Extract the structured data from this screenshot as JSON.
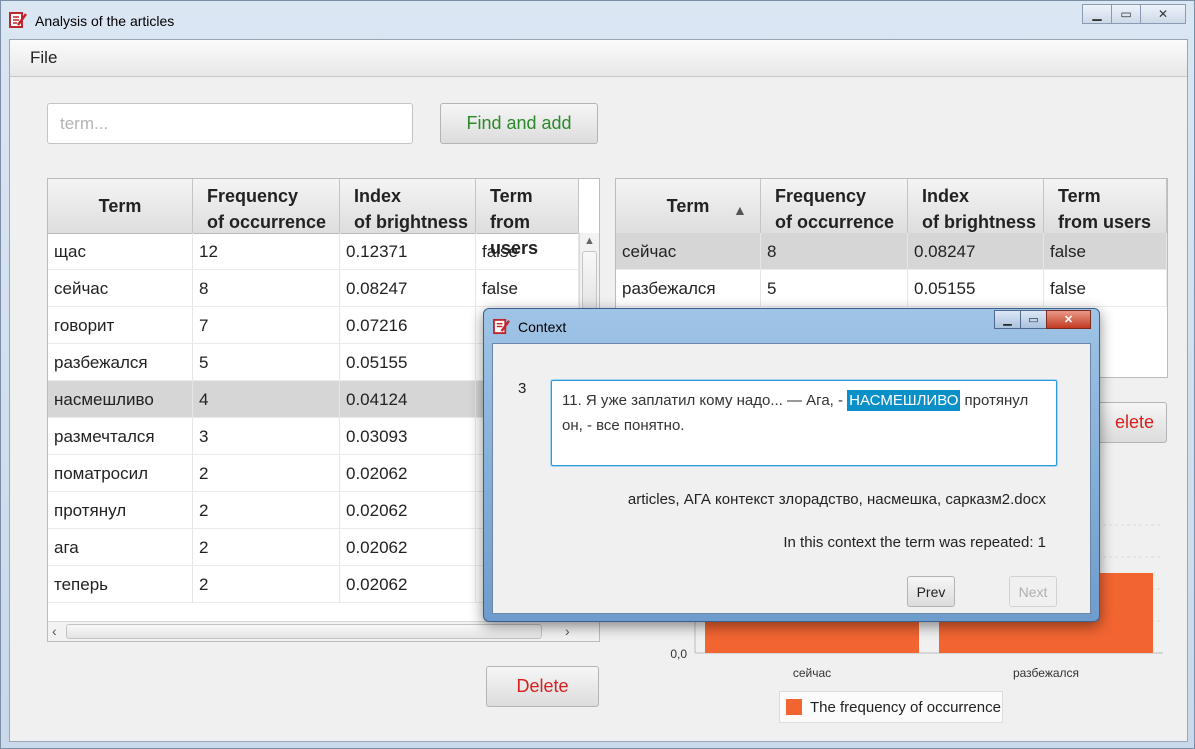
{
  "window": {
    "title": "Analysis of the articles"
  },
  "menu": {
    "file": "File"
  },
  "search": {
    "placeholder": "term...",
    "value": ""
  },
  "buttons": {
    "find_add": "Find and add",
    "delete_left": "Delete",
    "delete_right": "elete"
  },
  "colors": {
    "find_add_text": "#2a8a2a",
    "delete_text": "#d81e1e",
    "bar": "#f26531",
    "highlight": "#0a8fc7"
  },
  "left_table": {
    "headers": [
      {
        "line1": "Term",
        "line2": ""
      },
      {
        "line1": "Frequency",
        "line2": "of occurrence"
      },
      {
        "line1": "Index",
        "line2": "of brightness"
      },
      {
        "line1": "Term",
        "line2": "from users"
      }
    ],
    "rows": [
      [
        "щас",
        "12",
        "0.12371",
        "false"
      ],
      [
        "сейчас",
        "8",
        "0.08247",
        "false"
      ],
      [
        "говорит",
        "7",
        "0.07216",
        ""
      ],
      [
        "разбежался",
        "5",
        "0.05155",
        ""
      ],
      [
        "насмешливо",
        "4",
        "0.04124",
        ""
      ],
      [
        "размечтался",
        "3",
        "0.03093",
        ""
      ],
      [
        "поматросил",
        "2",
        "0.02062",
        ""
      ],
      [
        "протянул",
        "2",
        "0.02062",
        ""
      ],
      [
        "ага",
        "2",
        "0.02062",
        ""
      ],
      [
        "теперь",
        "2",
        "0.02062",
        ""
      ]
    ],
    "selected_row": 4
  },
  "right_table": {
    "headers": [
      {
        "line1": "Term",
        "line2": ""
      },
      {
        "line1": "Frequency",
        "line2": "of occurrence"
      },
      {
        "line1": "Index",
        "line2": "of brightness"
      },
      {
        "line1": "Term",
        "line2": "from users"
      }
    ],
    "sort_indicator": "▲",
    "rows": [
      [
        "сейчас",
        "8",
        "0.08247",
        "false"
      ],
      [
        "разбежался",
        "5",
        "0.05155",
        "false"
      ]
    ],
    "selected_row": 0
  },
  "chart_data": {
    "type": "bar",
    "categories": [
      "сейчас",
      "разбежался"
    ],
    "series": [
      {
        "name": "The frequency of occurrence",
        "values": [
          8,
          5
        ]
      }
    ],
    "y_tick_labels": [
      "0,0"
    ],
    "legend": "bottom"
  },
  "dialog": {
    "title": "Context",
    "index": "3",
    "text_before": "11. Я уже заплатил кому надо... — Ага, - ",
    "text_highlight": "НАСМЕШЛИВО",
    "text_after": " протянул он, - все понятно.",
    "file": "articles, АГА контекст злорадство, насмешка, сарказм2.docx",
    "repeated": "In this context the term was repeated: 1",
    "prev": "Prev",
    "next": "Next"
  }
}
